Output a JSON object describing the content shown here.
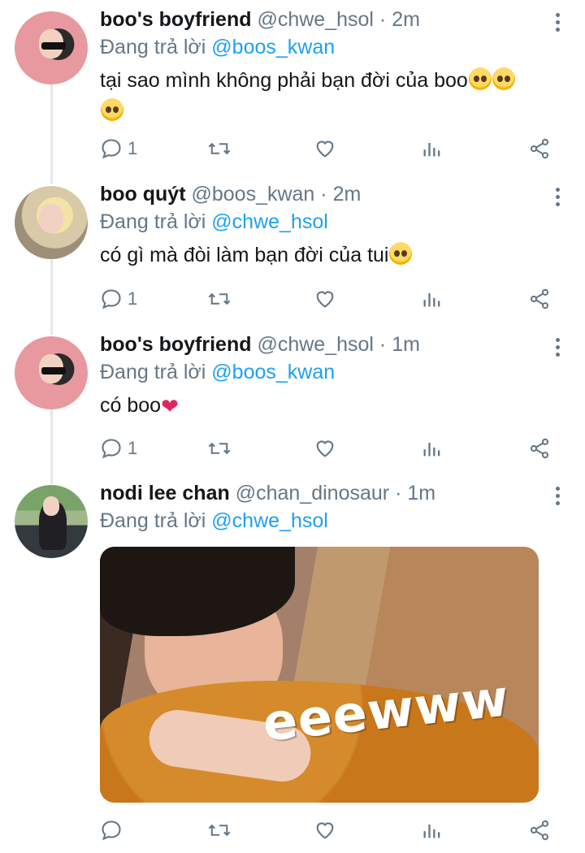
{
  "tweets": [
    {
      "name": "boo's boyfriend",
      "handle": "@chwe_hsol",
      "separator": "·",
      "time": "2m",
      "reply_prefix": "Đang trả lời",
      "reply_to": "@boos_kwan",
      "text": "tại sao mình không phải bạn đời của boo",
      "emojis": [
        "pleading-face-emoji",
        "pleading-face-emoji",
        "pleading-face-emoji"
      ],
      "reply_count": "1"
    },
    {
      "name": "boo quýt",
      "handle": "@boos_kwan",
      "separator": "·",
      "time": "2m",
      "reply_prefix": "Đang trả lời",
      "reply_to": "@chwe_hsol",
      "text": "có gì mà đòi làm bạn đời của tui",
      "emojis": [
        "thinking-face-emoji"
      ],
      "reply_count": "1"
    },
    {
      "name": "boo's boyfriend",
      "handle": "@chwe_hsol",
      "separator": "·",
      "time": "1m",
      "reply_prefix": "Đang trả lời",
      "reply_to": "@boos_kwan",
      "text": "có boo",
      "emojis": [
        "red-heart-emoji"
      ],
      "reply_count": "1"
    },
    {
      "name": "nodi lee chan",
      "handle": "@chan_dinosaur",
      "separator": "·",
      "time": "1m",
      "reply_prefix": "Đang trả lời",
      "reply_to": "@chwe_hsol",
      "media_caption": "eeewww",
      "reply_count": ""
    }
  ],
  "icons": {
    "reply": "reply-icon",
    "retweet": "retweet-icon",
    "like": "heart-icon",
    "analytics": "analytics-icon",
    "share": "share-icon",
    "more": "more-options-icon"
  },
  "colors": {
    "link": "#1da1f2",
    "secondary_text": "#657786",
    "primary_text": "#14171a",
    "thread_line": "#e1e8ed"
  }
}
